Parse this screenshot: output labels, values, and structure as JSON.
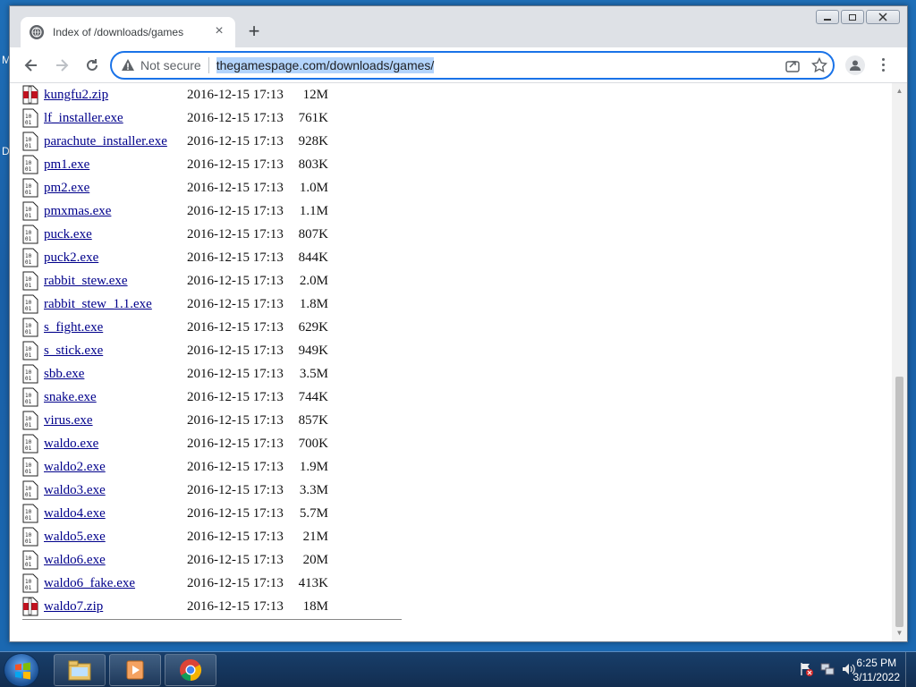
{
  "desktop": {
    "frag1": "M",
    "frag2": "D"
  },
  "browser": {
    "tab_title": "Index of /downloads/games",
    "tab_close": "×",
    "new_tab": "+",
    "security_label": "Not secure",
    "url": "thegamespage.com/downloads/games/"
  },
  "files": [
    {
      "name": "kungfu2.zip",
      "date": "2016-12-15 17:13",
      "size": "12M",
      "icon": "zip-icon"
    },
    {
      "name": "lf_installer.exe",
      "date": "2016-12-15 17:13",
      "size": "761K",
      "icon": "binary-file-icon"
    },
    {
      "name": "parachute_installer.exe",
      "date": "2016-12-15 17:13",
      "size": "928K",
      "icon": "binary-file-icon"
    },
    {
      "name": "pm1.exe",
      "date": "2016-12-15 17:13",
      "size": "803K",
      "icon": "binary-file-icon"
    },
    {
      "name": "pm2.exe",
      "date": "2016-12-15 17:13",
      "size": "1.0M",
      "icon": "binary-file-icon"
    },
    {
      "name": "pmxmas.exe",
      "date": "2016-12-15 17:13",
      "size": "1.1M",
      "icon": "binary-file-icon"
    },
    {
      "name": "puck.exe",
      "date": "2016-12-15 17:13",
      "size": "807K",
      "icon": "binary-file-icon"
    },
    {
      "name": "puck2.exe",
      "date": "2016-12-15 17:13",
      "size": "844K",
      "icon": "binary-file-icon"
    },
    {
      "name": "rabbit_stew.exe",
      "date": "2016-12-15 17:13",
      "size": "2.0M",
      "icon": "binary-file-icon"
    },
    {
      "name": "rabbit_stew_1.1.exe",
      "date": "2016-12-15 17:13",
      "size": "1.8M",
      "icon": "binary-file-icon"
    },
    {
      "name": "s_fight.exe",
      "date": "2016-12-15 17:13",
      "size": "629K",
      "icon": "binary-file-icon"
    },
    {
      "name": "s_stick.exe",
      "date": "2016-12-15 17:13",
      "size": "949K",
      "icon": "binary-file-icon"
    },
    {
      "name": "sbb.exe",
      "date": "2016-12-15 17:13",
      "size": "3.5M",
      "icon": "binary-file-icon"
    },
    {
      "name": "snake.exe",
      "date": "2016-12-15 17:13",
      "size": "744K",
      "icon": "binary-file-icon"
    },
    {
      "name": "virus.exe",
      "date": "2016-12-15 17:13",
      "size": "857K",
      "icon": "binary-file-icon"
    },
    {
      "name": "waldo.exe",
      "date": "2016-12-15 17:13",
      "size": "700K",
      "icon": "binary-file-icon"
    },
    {
      "name": "waldo2.exe",
      "date": "2016-12-15 17:13",
      "size": "1.9M",
      "icon": "binary-file-icon"
    },
    {
      "name": "waldo3.exe",
      "date": "2016-12-15 17:13",
      "size": "3.3M",
      "icon": "binary-file-icon"
    },
    {
      "name": "waldo4.exe",
      "date": "2016-12-15 17:13",
      "size": "5.7M",
      "icon": "binary-file-icon"
    },
    {
      "name": "waldo5.exe",
      "date": "2016-12-15 17:13",
      "size": "21M",
      "icon": "binary-file-icon"
    },
    {
      "name": "waldo6.exe",
      "date": "2016-12-15 17:13",
      "size": "20M",
      "icon": "binary-file-icon"
    },
    {
      "name": "waldo6_fake.exe",
      "date": "2016-12-15 17:13",
      "size": "413K",
      "icon": "binary-file-icon"
    },
    {
      "name": "waldo7.zip",
      "date": "2016-12-15 17:13",
      "size": "18M",
      "icon": "zip-icon"
    }
  ],
  "taskbar": {
    "time": "6:25 PM",
    "date": "3/11/2022",
    "apps": [
      "file-explorer-icon",
      "media-player-icon",
      "chrome-icon"
    ]
  },
  "colors": {
    "link": "#00008b",
    "omnibox_focus": "#1a73e8",
    "url_selection": "#b3d4fc"
  }
}
